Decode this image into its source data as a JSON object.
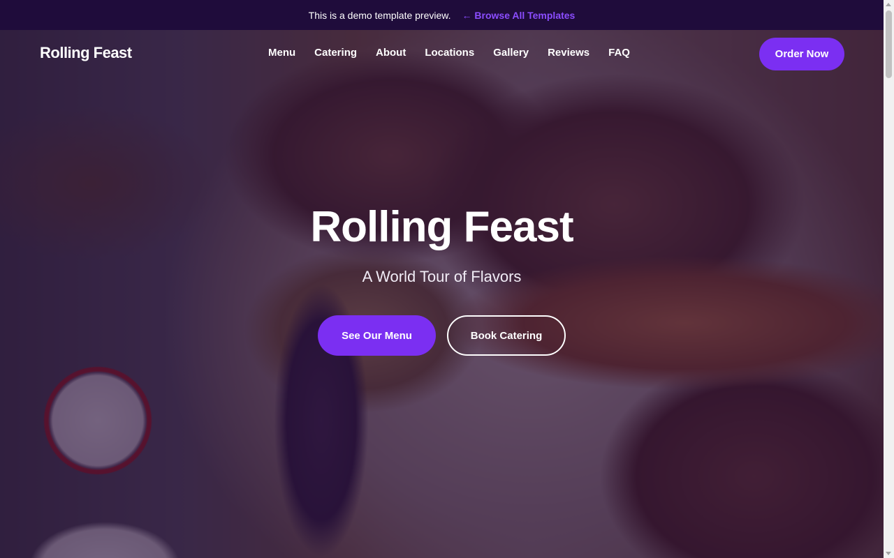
{
  "demo_bar": {
    "message": "This is a demo template preview.",
    "link_label": "← Browse All Templates"
  },
  "nav": {
    "brand": "Rolling Feast",
    "links": [
      "Menu",
      "Catering",
      "About",
      "Locations",
      "Gallery",
      "Reviews",
      "FAQ"
    ],
    "cta_label": "Order Now"
  },
  "hero": {
    "title": "Rolling Feast",
    "subtitle": "A World Tour of Flavors",
    "primary_cta": "See Our Menu",
    "secondary_cta": "Book Catering",
    "background_image": "grilled-meat-platter"
  },
  "colors": {
    "accent": "#7b2ff2",
    "demo_bar_bg": "#1f0c3b",
    "demo_link": "#8b4dff",
    "hero_overlay": "#280f3c"
  }
}
